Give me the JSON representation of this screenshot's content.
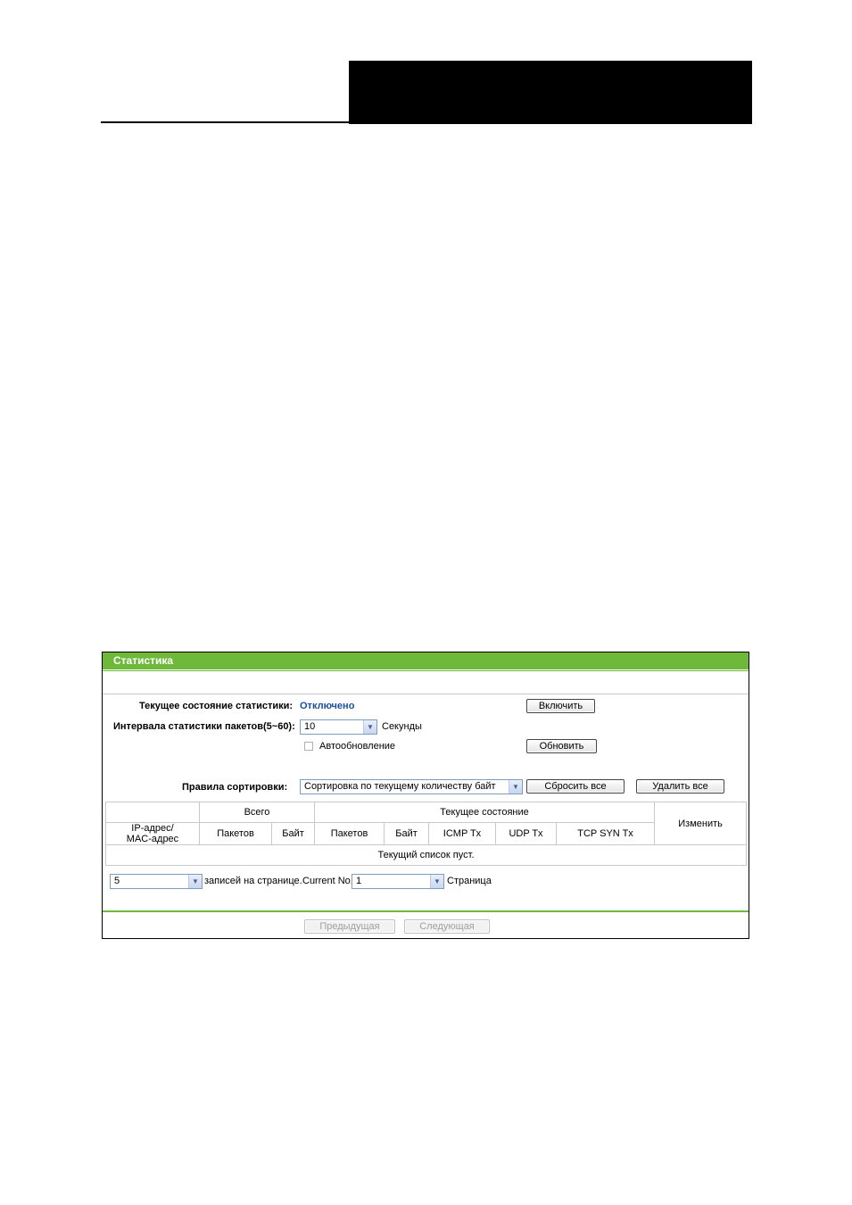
{
  "panel": {
    "title": "Статистика"
  },
  "status": {
    "label": "Текущее состояние статистики:",
    "value": "Отключено",
    "enable_button": "Включить"
  },
  "interval": {
    "label": "Интервала статистики пакетов(5~60):",
    "value": "10",
    "unit": "Секунды"
  },
  "auto_refresh": {
    "label": "Автообновление",
    "checked": false,
    "refresh_button": "Обновить"
  },
  "sorting": {
    "label": "Правила сортировки:",
    "value": "Сортировка по текущему количеству байт",
    "reset_all_button": "Сбросить все",
    "delete_all_button": "Удалить все"
  },
  "table": {
    "group_total": "Всего",
    "group_current": "Текущее состояние",
    "col_ipmac_line1": "IP-адрес/",
    "col_ipmac_line2": "MAC-адрес",
    "col_edit": "Изменить",
    "total_cols": [
      "Пакетов",
      "Байт"
    ],
    "current_cols": [
      "Пакетов",
      "Байт",
      "ICMP Tx",
      "UDP Tx",
      "TCP SYN Tx"
    ],
    "empty_message": "Текущий список пуст."
  },
  "pagination": {
    "per_page_value": "5",
    "per_page_label": "записей на странице.",
    "current_label": "Current No.",
    "current_value": "1",
    "page_label": "Страница",
    "prev_button": "Предыдущая",
    "next_button": "Следующая"
  }
}
